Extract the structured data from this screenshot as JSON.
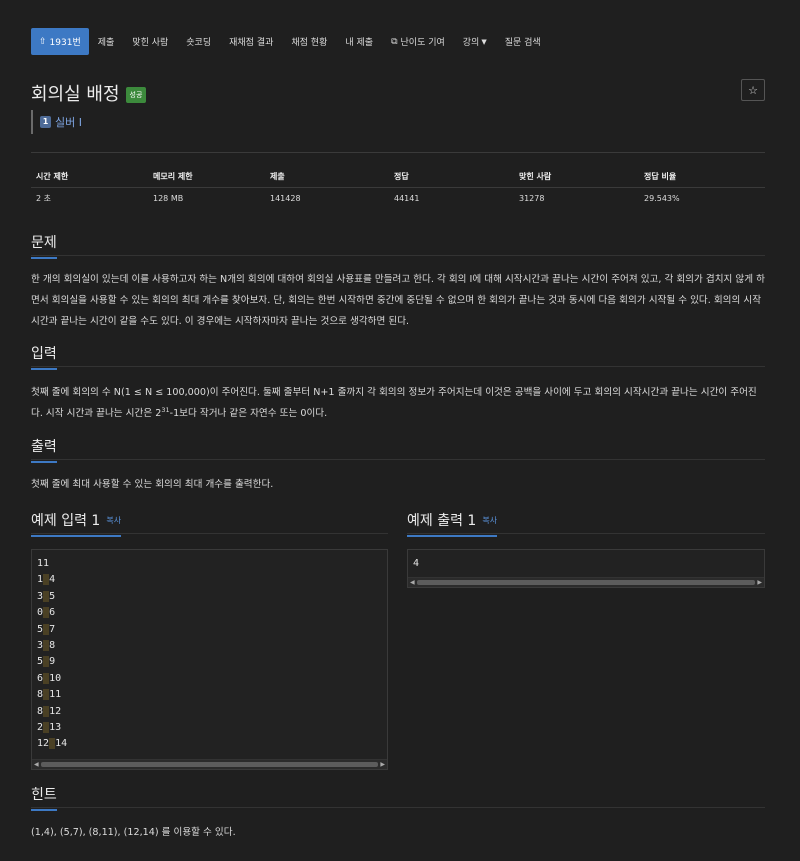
{
  "nav": {
    "tabs": [
      {
        "label": "1931번",
        "icon": "upload-icon",
        "active": true
      },
      {
        "label": "제출"
      },
      {
        "label": "맞힌 사람"
      },
      {
        "label": "숏코딩"
      },
      {
        "label": "재채점 결과"
      },
      {
        "label": "채점 현황"
      },
      {
        "label": "내 제출"
      },
      {
        "label": "난이도 기여",
        "icon": "external-link-icon"
      },
      {
        "label": "강의",
        "icon": "caret-down-icon"
      },
      {
        "label": "질문 검색"
      }
    ]
  },
  "problem": {
    "title": "회의실 배정",
    "status_badge": "성공",
    "star_icon": "star-icon",
    "tier_label": "실버 I",
    "tier_icon_text": "1"
  },
  "stats": {
    "headers": [
      "시간 제한",
      "메모리 제한",
      "제출",
      "정답",
      "맞힌 사람",
      "정답 비율"
    ],
    "values": [
      "2 초",
      "128 MB",
      "141428",
      "44141",
      "31278",
      "29.543%"
    ]
  },
  "sections": {
    "description": {
      "heading": "문제",
      "text": "한 개의 회의실이 있는데 이를 사용하고자 하는 N개의 회의에 대하여 회의실 사용표를 만들려고 한다. 각 회의 I에 대해 시작시간과 끝나는 시간이 주어져 있고, 각 회의가 겹치지 않게 하면서 회의실을 사용할 수 있는 회의의 최대 개수를 찾아보자. 단, 회의는 한번 시작하면 중간에 중단될 수 없으며 한 회의가 끝나는 것과 동시에 다음 회의가 시작될 수 있다. 회의의 시작시간과 끝나는 시간이 같을 수도 있다. 이 경우에는 시작하자마자 끝나는 것으로 생각하면 된다."
    },
    "input": {
      "heading": "입력",
      "text_before": "첫째 줄에 회의의 수 N(1 ≤ N ≤ 100,000)이 주어진다. 둘째 줄부터 N+1 줄까지 각 회의의 정보가 주어지는데 이것은 공백을 사이에 두고 회의의 시작시간과 끝나는 시간이 주어진다. 시작 시간과 끝나는 시간은 2",
      "sup": "31",
      "text_after": "-1보다 작거나 같은 자연수 또는 0이다."
    },
    "output": {
      "heading": "출력",
      "text": "첫째 줄에 최대 사용할 수 있는 회의의 최대 개수를 출력한다."
    },
    "sample_input": {
      "heading": "예제 입력 1",
      "copy_label": "복사",
      "lines": [
        {
          "a": "11",
          "b": ""
        },
        {
          "a": "1",
          "b": "4"
        },
        {
          "a": "3",
          "b": "5"
        },
        {
          "a": "0",
          "b": "6"
        },
        {
          "a": "5",
          "b": "7"
        },
        {
          "a": "3",
          "b": "8"
        },
        {
          "a": "5",
          "b": "9"
        },
        {
          "a": "6",
          "b": "10"
        },
        {
          "a": "8",
          "b": "11"
        },
        {
          "a": "8",
          "b": "12"
        },
        {
          "a": "2",
          "b": "13"
        },
        {
          "a": "12",
          "b": "14"
        }
      ]
    },
    "sample_output": {
      "heading": "예제 출력 1",
      "copy_label": "복사",
      "lines": [
        "4"
      ]
    },
    "hint": {
      "heading": "힌트",
      "text": "(1,4), (5,7), (8,11), (12,14) 를 이용할 수 있다."
    }
  },
  "colors": {
    "background": "#1f1f1f",
    "accent": "#3d79c4",
    "success": "#3c8a3c",
    "link": "#5b95df"
  }
}
